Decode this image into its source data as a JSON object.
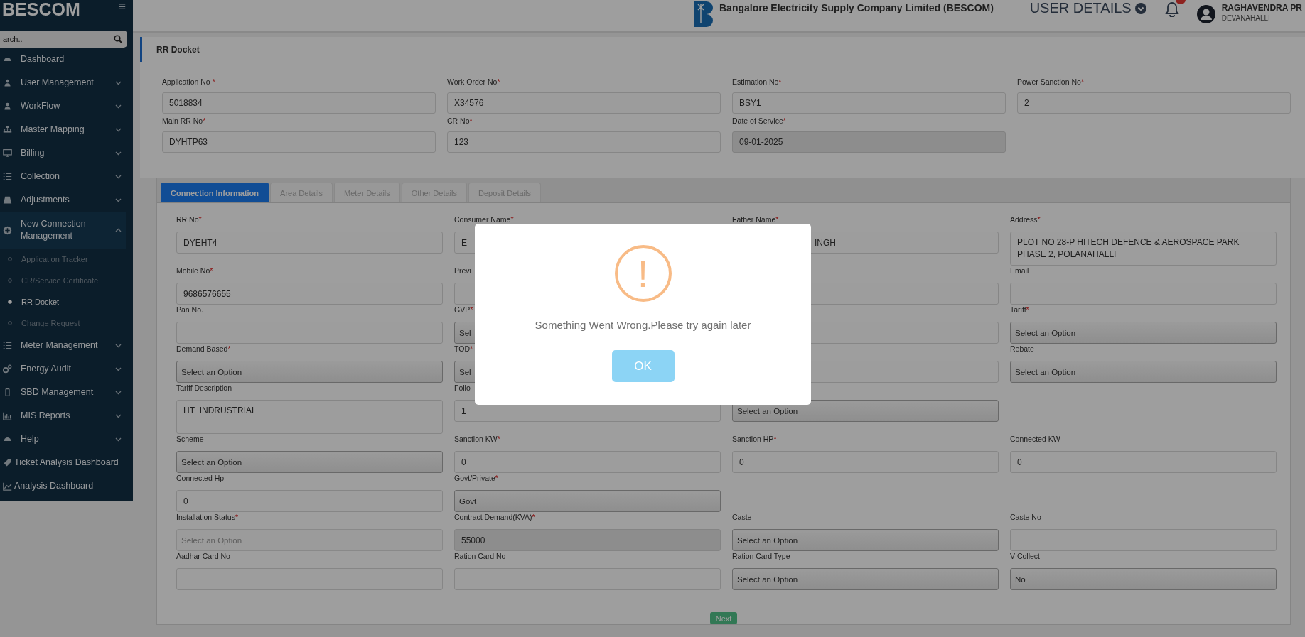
{
  "sidebar": {
    "brand": "BESCOM",
    "menu_glyph": "≡",
    "search": {
      "placeholder": "arch.."
    },
    "items": [
      {
        "label": "Dashboard"
      },
      {
        "label": "User Management",
        "expanded": false
      },
      {
        "label": "WorkFlow",
        "expanded": false
      },
      {
        "label": "Master Mapping",
        "expanded": false
      },
      {
        "label": "Billing",
        "expanded": false
      },
      {
        "label": "Collection",
        "expanded": false
      },
      {
        "label": "Adjustments",
        "expanded": false
      },
      {
        "label": "New Connection Management",
        "expanded": true,
        "children": [
          {
            "label": "Application Tracker",
            "selected": false
          },
          {
            "label": "CR/Service Certificate",
            "selected": false
          },
          {
            "label": "RR Docket",
            "selected": true
          },
          {
            "label": "Change Request",
            "selected": false
          }
        ]
      },
      {
        "label": "Meter Management",
        "expanded": false
      },
      {
        "label": "Energy Audit",
        "expanded": false
      },
      {
        "label": "SBD Management",
        "expanded": false
      },
      {
        "label": "MIS Reports",
        "expanded": false
      },
      {
        "label": "Help",
        "expanded": false
      },
      {
        "label": "Ticket Analysis Dashboard"
      },
      {
        "label": "Analysis Dashboard"
      }
    ]
  },
  "header": {
    "company": "Bangalore Electricity Supply Company Limited (BESCOM)",
    "user_details": "USER DETAILS",
    "user_name": "RAGHAVENDRA PR",
    "user_location": "DEVANAHALLI"
  },
  "page_title": "RR Docket",
  "top_fields": [
    [
      {
        "label": "Application No ",
        "required_mark": "*",
        "value": "5018834",
        "disabled": false
      },
      {
        "label": "Work Order No",
        "required_mark": "*",
        "value": "X34576",
        "disabled": false
      },
      {
        "label": "Estimation No",
        "required_mark": "*",
        "value": "BSY1",
        "disabled": false
      },
      {
        "label": "Power Sanction No",
        "required_mark": "*",
        "value": "2",
        "disabled": false
      }
    ],
    [
      {
        "label": "Main RR No",
        "required_mark": "*",
        "value": "DYHTP63",
        "disabled": false
      },
      {
        "label": "CR No",
        "required_mark": "*",
        "value": "123",
        "disabled": false
      },
      {
        "label": "Date of Service",
        "required_mark": "*",
        "value": "09-01-2025",
        "disabled": true
      }
    ]
  ],
  "tabs": [
    {
      "label": "Connection Information",
      "selected": true
    },
    {
      "label": "Area Details",
      "selected": false
    },
    {
      "label": "Meter Details",
      "selected": false
    },
    {
      "label": "Other Details",
      "selected": false
    },
    {
      "label": "Deposit Details",
      "selected": false
    }
  ],
  "form_rows": [
    [
      {
        "kind": "input",
        "label": "RR No",
        "required_mark": "*",
        "value": "DYEHT4"
      },
      {
        "kind": "input",
        "label": "Consumer Name",
        "required_mark": "*",
        "value": "E"
      },
      {
        "kind": "input",
        "label": "Father Name",
        "required_mark": "*",
        "value": "INGH"
      },
      {
        "kind": "textarea",
        "label": "Address",
        "required_mark": "*",
        "value": "PLOT NO 28-P HITECH DEFENCE & AEROSPACE PARK PHASE 2, POLANAHALLI"
      }
    ],
    [
      {
        "kind": "input",
        "label": "Mobile No",
        "required_mark": "*",
        "value": "9686576655"
      },
      {
        "kind": "input",
        "label": "Previ"
      },
      {
        "kind": "input"
      },
      {
        "kind": "input",
        "label": "Email"
      }
    ],
    [
      {
        "kind": "input",
        "label": "Pan No."
      },
      {
        "kind": "select",
        "label": "GVP",
        "required_mark": "*",
        "value": "Sel"
      },
      {
        "kind": "input"
      },
      {
        "kind": "select",
        "label": "Tariff",
        "required_mark": "*",
        "value": "Select an Option"
      }
    ],
    [
      {
        "kind": "select",
        "label": "Demand Based",
        "required_mark": "*",
        "value": "Select an Option"
      },
      {
        "kind": "select",
        "label": "TOD",
        "required_mark": "*",
        "value": "Sel"
      },
      {
        "kind": "input"
      },
      {
        "kind": "select",
        "label": "Rebate",
        "value": "Select an Option"
      }
    ],
    [
      {
        "kind": "textarea",
        "label": "Tariff Description",
        "value": "HT_INDRUSTRIAL"
      },
      {
        "kind": "input",
        "label": "Folio",
        "value": "1"
      },
      {
        "kind": "select",
        "value": "Select an Option"
      }
    ],
    [
      {
        "kind": "select",
        "label": "Scheme",
        "value": "Select an Option"
      },
      {
        "kind": "input",
        "label": "Sanction KW",
        "required_mark": "*",
        "value": "0"
      },
      {
        "kind": "input",
        "label": "Sanction HP",
        "required_mark": "*",
        "value": "0"
      },
      {
        "kind": "input",
        "label": "Connected KW",
        "value": "0"
      }
    ],
    [
      {
        "kind": "input",
        "label": "Connected Hp",
        "value": "0"
      },
      {
        "kind": "select",
        "label": "Govt/Private",
        "required_mark": "*",
        "value": "Govt"
      }
    ],
    [
      {
        "kind": "select",
        "label": "Installation Status",
        "required_mark": "*",
        "placeholder": "Select an Option"
      },
      {
        "kind": "disabled",
        "label": "Contract Demand(KVA)",
        "required_mark": "*",
        "value": "55000"
      },
      {
        "kind": "select",
        "label": "Caste",
        "value": "Select an Option"
      },
      {
        "kind": "input",
        "label": "Caste No"
      }
    ],
    [
      {
        "kind": "input",
        "label": "Aadhar Card No"
      },
      {
        "kind": "input",
        "label": "Ration Card No"
      },
      {
        "kind": "select",
        "label": "Ration Card Type",
        "value": "Select an Option"
      },
      {
        "kind": "select",
        "label": "V-Collect",
        "value": "No"
      }
    ]
  ],
  "next_button": "Next",
  "dialog": {
    "icon_glyph": "!",
    "message": "Something Went Wrong.Please try again later",
    "ok_button": "OK"
  }
}
